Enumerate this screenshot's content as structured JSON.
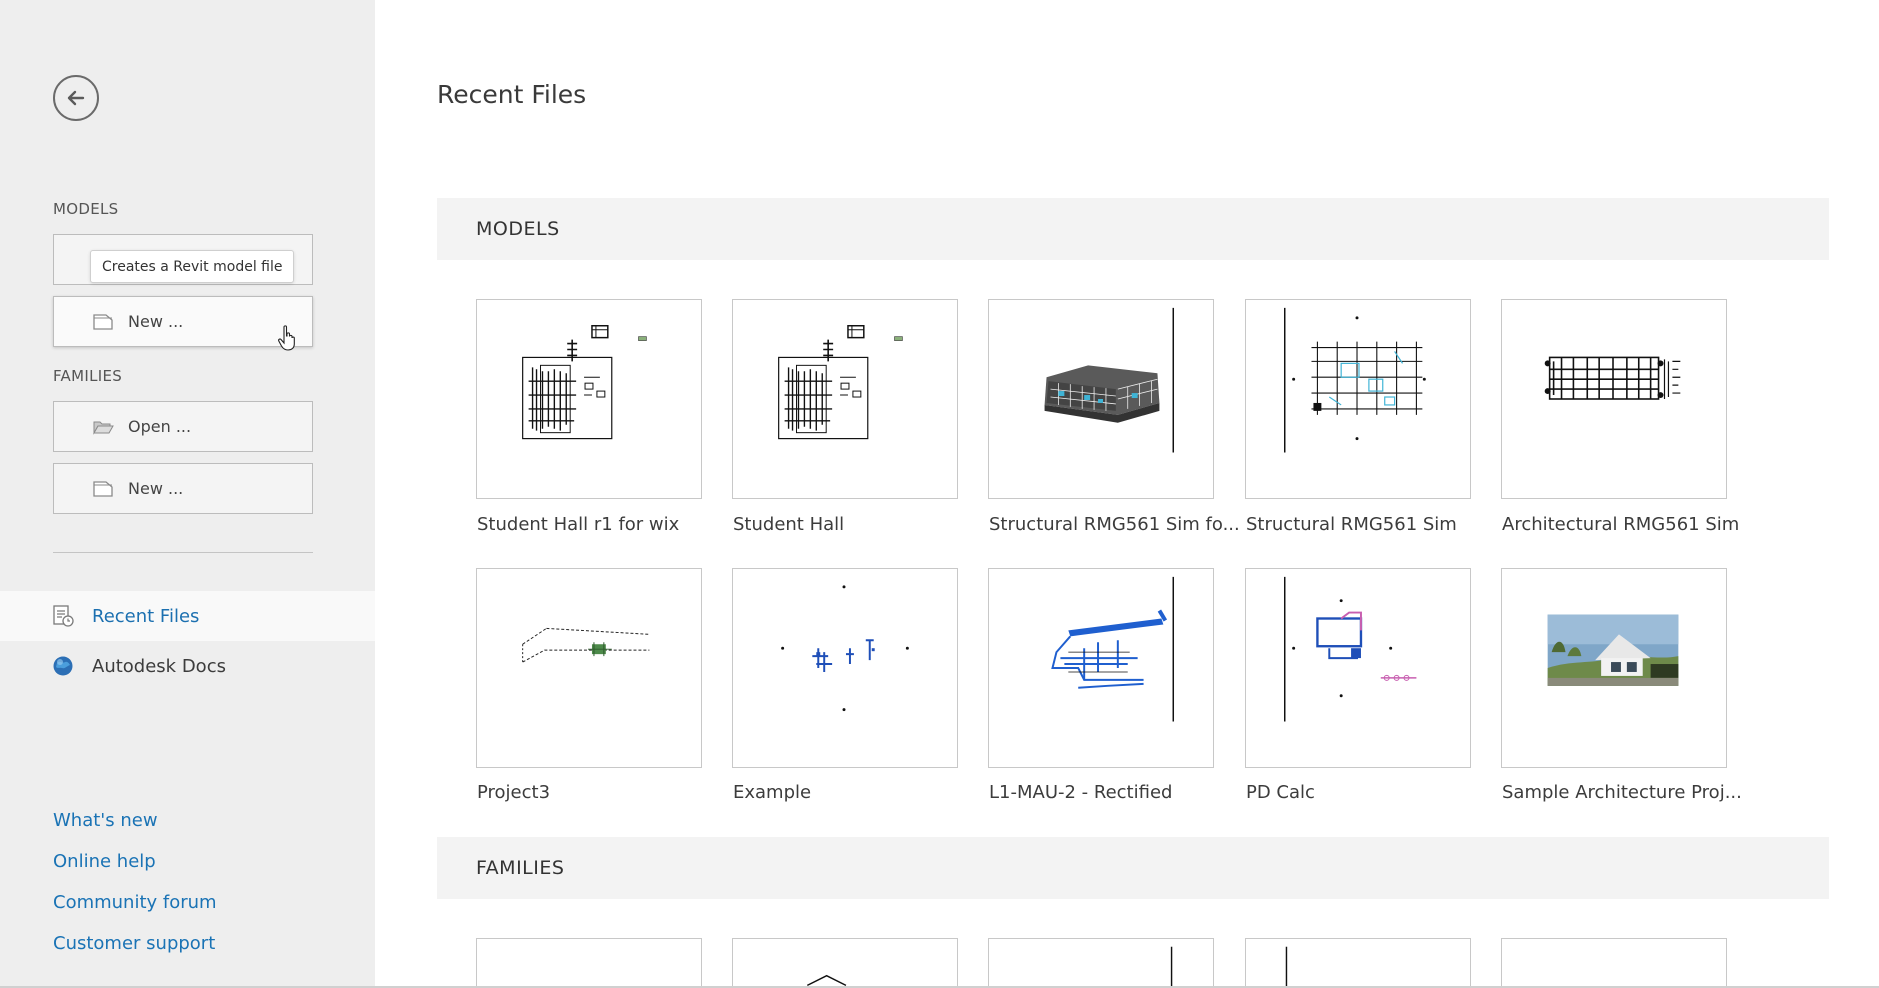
{
  "sidebar": {
    "back_icon": "arrow-left-circle-icon",
    "models_heading": "MODELS",
    "models_open_tooltip": "Creates a Revit model file",
    "models_new_label": "New ...",
    "families_heading": "FAMILIES",
    "families_open_label": "Open ...",
    "families_new_label": "New ...",
    "nav": [
      {
        "label": "Recent Files",
        "icon": "recent-files-icon",
        "active": true
      },
      {
        "label": "Autodesk Docs",
        "icon": "globe-icon",
        "active": false
      }
    ],
    "links": [
      "What's new",
      "Online help",
      "Community forum",
      "Customer support"
    ]
  },
  "main": {
    "title": "Recent Files",
    "models_section": "MODELS",
    "families_section": "FAMILIES",
    "models": [
      {
        "name": "Student Hall r1 for wix"
      },
      {
        "name": "Student Hall"
      },
      {
        "name": "Structural RMG561 Sim fo..."
      },
      {
        "name": "Structural RMG561 Sim"
      },
      {
        "name": "Architectural RMG561 Sim"
      },
      {
        "name": "Project3"
      },
      {
        "name": "Example"
      },
      {
        "name": "L1-MAU-2 - Rectified"
      },
      {
        "name": "PD Calc"
      },
      {
        "name": "Sample Architecture Proj..."
      }
    ]
  },
  "colors": {
    "accent": "#1c70b0",
    "sidebar_bg": "#eeeeee",
    "section_bg": "#f3f3f3"
  }
}
